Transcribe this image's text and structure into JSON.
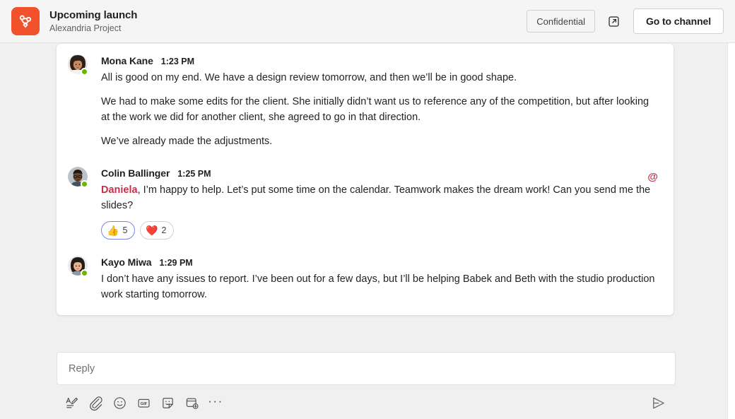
{
  "header": {
    "app_icon": "knot-logo-icon",
    "title": "Upcoming launch",
    "subtitle": "Alexandria Project",
    "confidential_label": "Confidential",
    "popout_icon": "open-in-new-window-icon",
    "go_to_channel_label": "Go to channel",
    "accent_color": "#f1512b"
  },
  "thread": {
    "messages": [
      {
        "author": "Mona Kane",
        "time": "1:23 PM",
        "presence": "available",
        "avatar": "avatar-mona-kane",
        "paragraphs": [
          "All is good on my end. We have a design review tomorrow, and then we’ll be in good shape.",
          "We had to make some edits for the client. She initially didn’t want us to reference any of the competition, but after looking at the work we did for another client, she agreed to go in that direction.",
          "We’ve already made the adjustments."
        ],
        "mention": null,
        "mention_flag": false,
        "reactions": []
      },
      {
        "author": "Colin Ballinger",
        "time": "1:25 PM",
        "presence": "available",
        "avatar": "avatar-colin-ballinger",
        "mention": "Daniela",
        "paragraphs": [
          ", I’m happy to help. Let’s put some time on the calendar. Teamwork makes the dream work! Can you send me the slides?"
        ],
        "mention_flag": true,
        "mention_flag_glyph": "@",
        "reactions": [
          {
            "emoji": "👍",
            "name": "thumbs-up",
            "count": "5",
            "active": true
          },
          {
            "emoji": "❤️",
            "name": "heart",
            "count": "2",
            "active": false
          }
        ]
      },
      {
        "author": "Kayo Miwa",
        "time": "1:29 PM",
        "presence": "available",
        "avatar": "avatar-kayo-miwa",
        "mention": null,
        "paragraphs": [
          "I don’t have any issues to report. I’ve been out for a few days, but I’ll be helping Babek and Beth with the studio production work starting tomorrow."
        ],
        "mention_flag": false,
        "reactions": []
      }
    ]
  },
  "composer": {
    "placeholder": "Reply",
    "value": "",
    "tools": [
      {
        "name": "format-text-icon",
        "label": "Format"
      },
      {
        "name": "attach-file-icon",
        "label": "Attach"
      },
      {
        "name": "emoji-icon",
        "label": "Emoji"
      },
      {
        "name": "gif-icon",
        "label": "GIF"
      },
      {
        "name": "sticker-icon",
        "label": "Sticker"
      },
      {
        "name": "apps-add-icon",
        "label": "Apps"
      },
      {
        "name": "more-options-icon",
        "label": "···"
      }
    ],
    "send": {
      "name": "send-icon",
      "label": "Send"
    }
  },
  "colors": {
    "mention": "#c4314b",
    "presence_available": "#6bb700",
    "reaction_active_border": "#7b83eb",
    "page_background": "#f0f0f0"
  }
}
